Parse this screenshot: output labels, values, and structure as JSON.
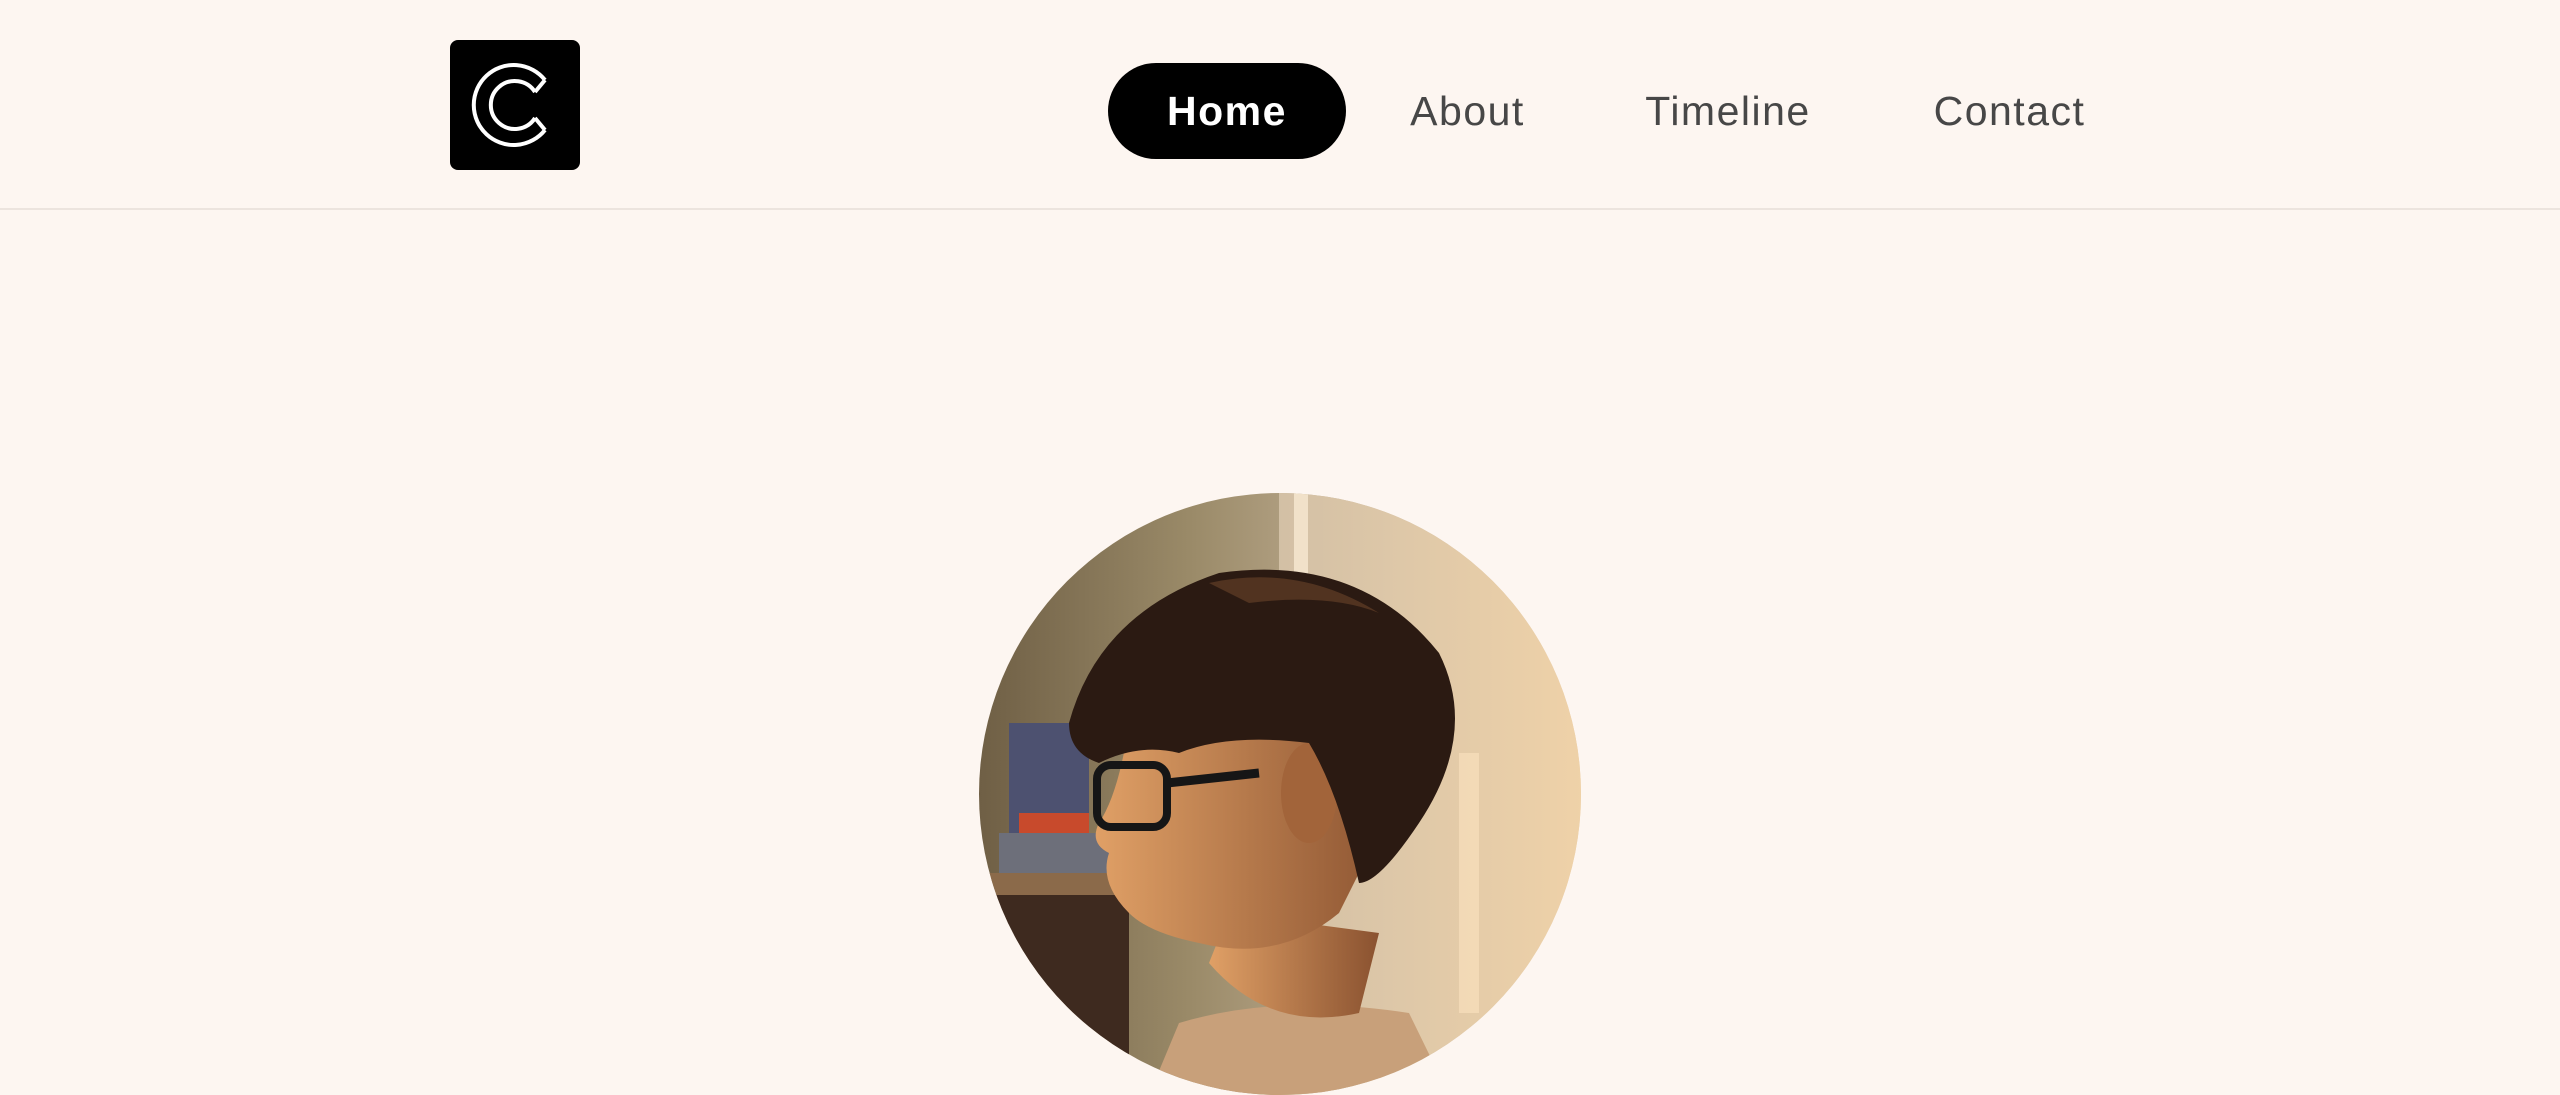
{
  "header": {
    "logo": {
      "letter": "C",
      "icon": "c-logo-icon",
      "background": "#000000",
      "foreground": "#ffffff"
    },
    "nav": [
      {
        "label": "Home",
        "active": true
      },
      {
        "label": "About",
        "active": false
      },
      {
        "label": "Timeline",
        "active": false
      },
      {
        "label": "Contact",
        "active": false
      }
    ]
  },
  "main": {
    "avatar": {
      "icon": "profile-photo"
    }
  },
  "colors": {
    "page_background": "#fdf6f1",
    "nav_active_background": "#000000",
    "nav_text": "#474747"
  }
}
